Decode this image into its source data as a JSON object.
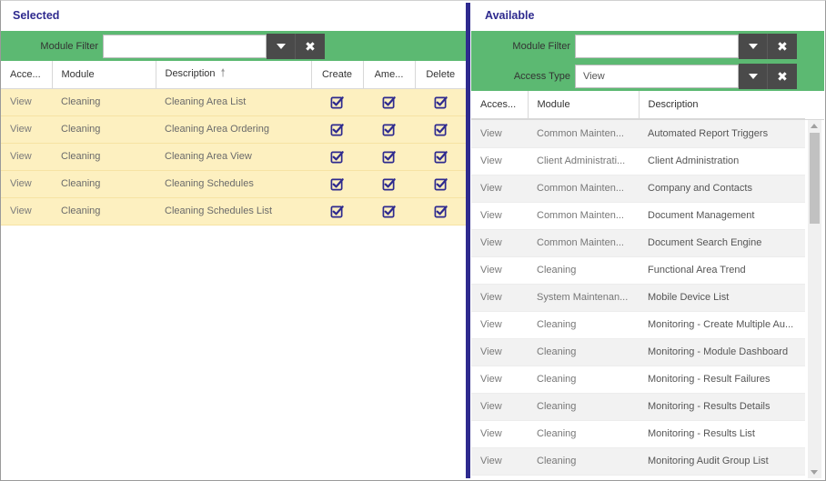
{
  "selected": {
    "title": "Selected",
    "filter": {
      "label": "Module Filter",
      "value": ""
    },
    "columns": {
      "access": "Acce...",
      "module": "Module",
      "description": "Description",
      "create": "Create",
      "amend": "Ame...",
      "delete": "Delete"
    },
    "rows": [
      {
        "access": "View",
        "module": "Cleaning",
        "description": "Cleaning Area List",
        "create": true,
        "amend": true,
        "delete": true
      },
      {
        "access": "View",
        "module": "Cleaning",
        "description": "Cleaning Area Ordering",
        "create": true,
        "amend": true,
        "delete": true
      },
      {
        "access": "View",
        "module": "Cleaning",
        "description": "Cleaning Area View",
        "create": true,
        "amend": true,
        "delete": true
      },
      {
        "access": "View",
        "module": "Cleaning",
        "description": "Cleaning Schedules",
        "create": true,
        "amend": true,
        "delete": true
      },
      {
        "access": "View",
        "module": "Cleaning",
        "description": "Cleaning Schedules List",
        "create": true,
        "amend": true,
        "delete": true
      }
    ]
  },
  "available": {
    "title": "Available",
    "module_filter": {
      "label": "Module Filter",
      "value": ""
    },
    "access_type": {
      "label": "Access Type",
      "value": "View"
    },
    "columns": {
      "access": "Acces...",
      "module": "Module",
      "description": "Description"
    },
    "rows": [
      {
        "access": "View",
        "module": "Common Mainten...",
        "description": "Automated Report Triggers"
      },
      {
        "access": "View",
        "module": "Client Administrati...",
        "description": "Client Administration"
      },
      {
        "access": "View",
        "module": "Common Mainten...",
        "description": "Company and Contacts"
      },
      {
        "access": "View",
        "module": "Common Mainten...",
        "description": "Document Management"
      },
      {
        "access": "View",
        "module": "Common Mainten...",
        "description": "Document Search Engine"
      },
      {
        "access": "View",
        "module": "Cleaning",
        "description": "Functional Area Trend"
      },
      {
        "access": "View",
        "module": "System Maintenan...",
        "description": "Mobile Device List"
      },
      {
        "access": "View",
        "module": "Cleaning",
        "description": "Monitoring - Create Multiple Au..."
      },
      {
        "access": "View",
        "module": "Cleaning",
        "description": "Monitoring - Module Dashboard"
      },
      {
        "access": "View",
        "module": "Cleaning",
        "description": "Monitoring - Result Failures"
      },
      {
        "access": "View",
        "module": "Cleaning",
        "description": "Monitoring - Results Details"
      },
      {
        "access": "View",
        "module": "Cleaning",
        "description": "Monitoring - Results List"
      },
      {
        "access": "View",
        "module": "Cleaning",
        "description": "Monitoring Audit Group List"
      }
    ]
  },
  "colors": {
    "accent": "#2e2a8e",
    "filter_bar": "#5cb972",
    "selected_row": "#fdf0c0",
    "check": "#2e2a8e"
  },
  "icons": {
    "dropdown": "chevron-down-icon",
    "clear": "close-icon",
    "sort": "sort-ascending-icon",
    "checked": "checkbox-checked-icon"
  }
}
